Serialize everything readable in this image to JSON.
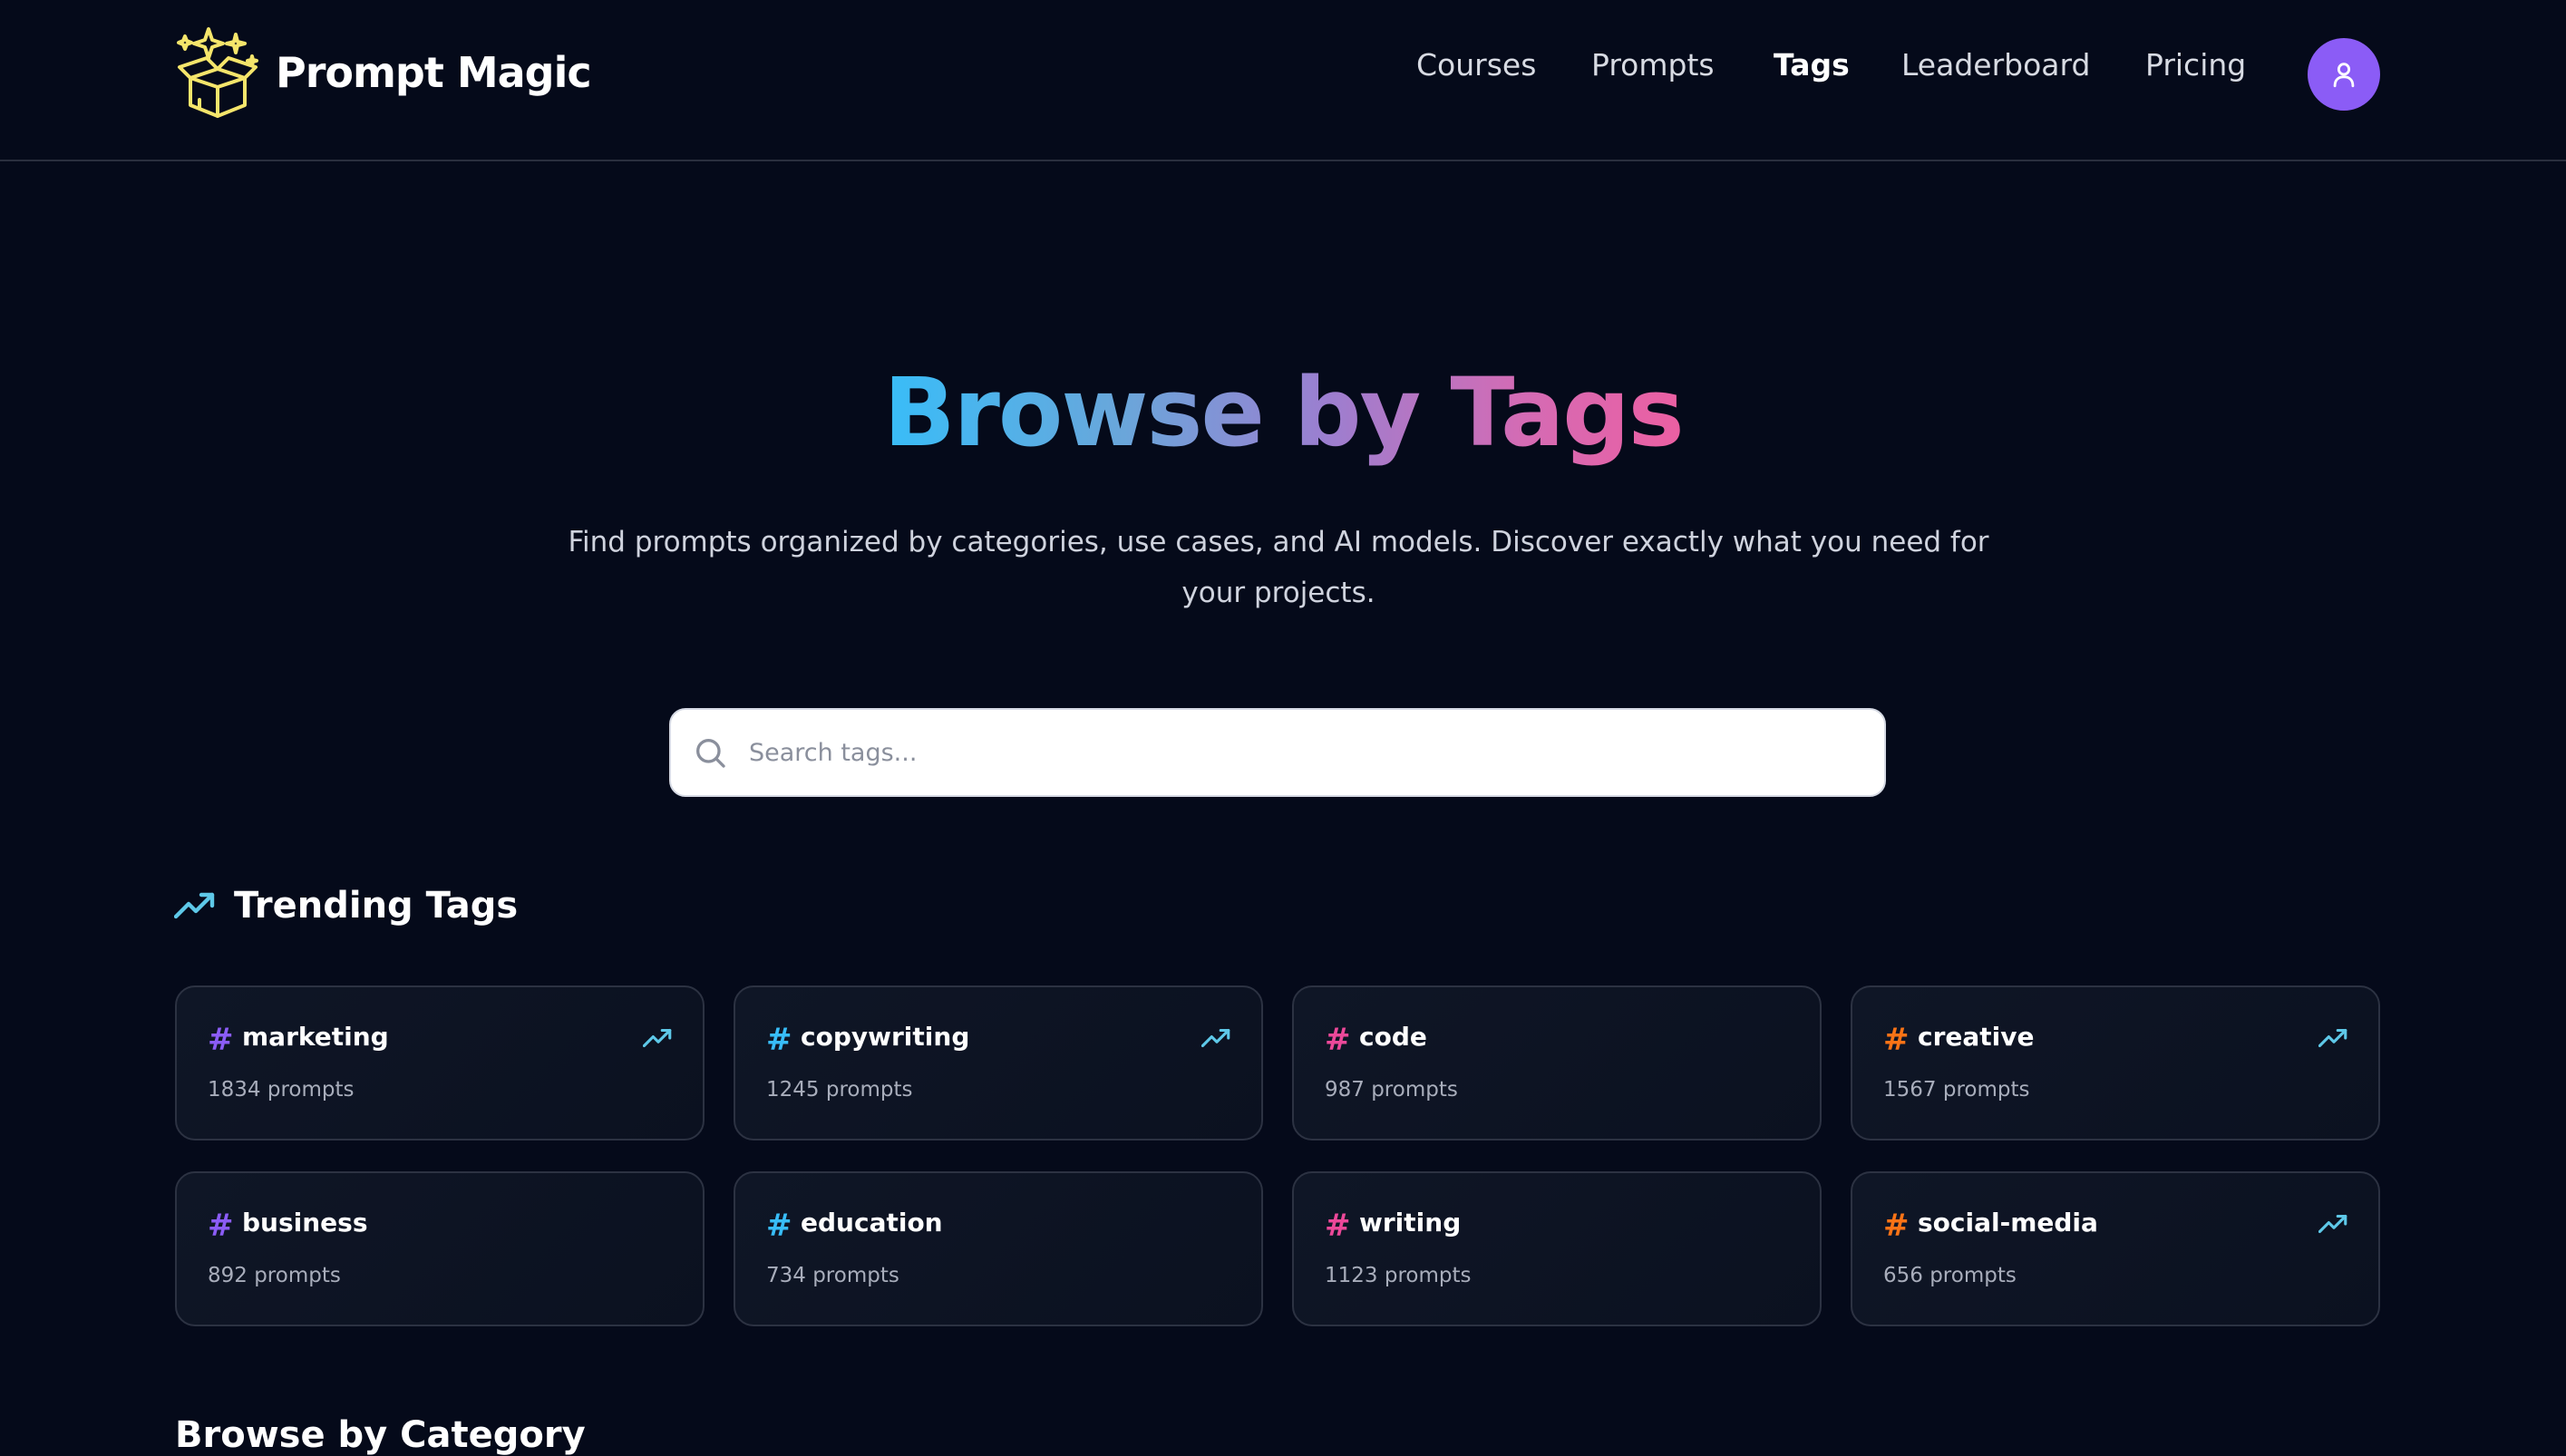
{
  "brand": {
    "name": "Prompt Magic",
    "logo_icon": "magic-box-icon",
    "logo_color": "#f5e56b"
  },
  "nav": {
    "items": [
      {
        "label": "Courses",
        "active": false
      },
      {
        "label": "Prompts",
        "active": false
      },
      {
        "label": "Tags",
        "active": true
      },
      {
        "label": "Leaderboard",
        "active": false
      },
      {
        "label": "Pricing",
        "active": false
      }
    ],
    "avatar_icon": "user-icon",
    "avatar_color": "#8b5cf6"
  },
  "hero": {
    "title": "Browse by Tags",
    "subtitle": "Find prompts organized by categories, use cases, and AI models. Discover exactly what you need for your projects."
  },
  "search": {
    "placeholder": "Search tags...",
    "value": "",
    "icon": "search-icon"
  },
  "trending": {
    "heading": "Trending Tags",
    "icon": "trending-up-icon",
    "icon_color": "#5ec8e8",
    "tags": [
      {
        "name": "marketing",
        "count": "1834 prompts",
        "hash_color": "#8b5cf6",
        "trending": true
      },
      {
        "name": "copywriting",
        "count": "1245 prompts",
        "hash_color": "#38bdf8",
        "trending": true
      },
      {
        "name": "code",
        "count": "987 prompts",
        "hash_color": "#ec4899",
        "trending": false
      },
      {
        "name": "creative",
        "count": "1567 prompts",
        "hash_color": "#f97316",
        "trending": true
      },
      {
        "name": "business",
        "count": "892 prompts",
        "hash_color": "#8b5cf6",
        "trending": false
      },
      {
        "name": "education",
        "count": "734 prompts",
        "hash_color": "#38bdf8",
        "trending": false
      },
      {
        "name": "writing",
        "count": "1123 prompts",
        "hash_color": "#ec4899",
        "trending": false
      },
      {
        "name": "social-media",
        "count": "656 prompts",
        "hash_color": "#f97316",
        "trending": true
      }
    ]
  },
  "category": {
    "heading": "Browse by Category"
  }
}
